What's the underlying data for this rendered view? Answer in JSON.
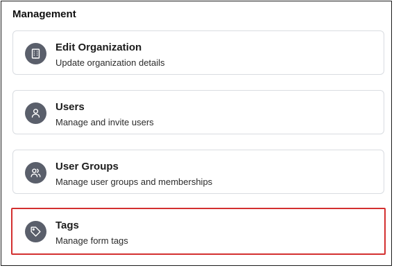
{
  "section": {
    "title": "Management"
  },
  "cards": [
    {
      "title": "Edit Organization",
      "description": "Update organization details",
      "icon": "building-icon"
    },
    {
      "title": "Users",
      "description": "Manage and invite users",
      "icon": "user-icon"
    },
    {
      "title": "User Groups",
      "description": "Manage user groups and memberships",
      "icon": "users-icon"
    },
    {
      "title": "Tags",
      "description": "Manage form tags",
      "icon": "tag-icon"
    }
  ],
  "colors": {
    "icon_bg": "#5a5f6b",
    "highlight_border": "#d32f2f",
    "card_border": "#d9dce1"
  }
}
